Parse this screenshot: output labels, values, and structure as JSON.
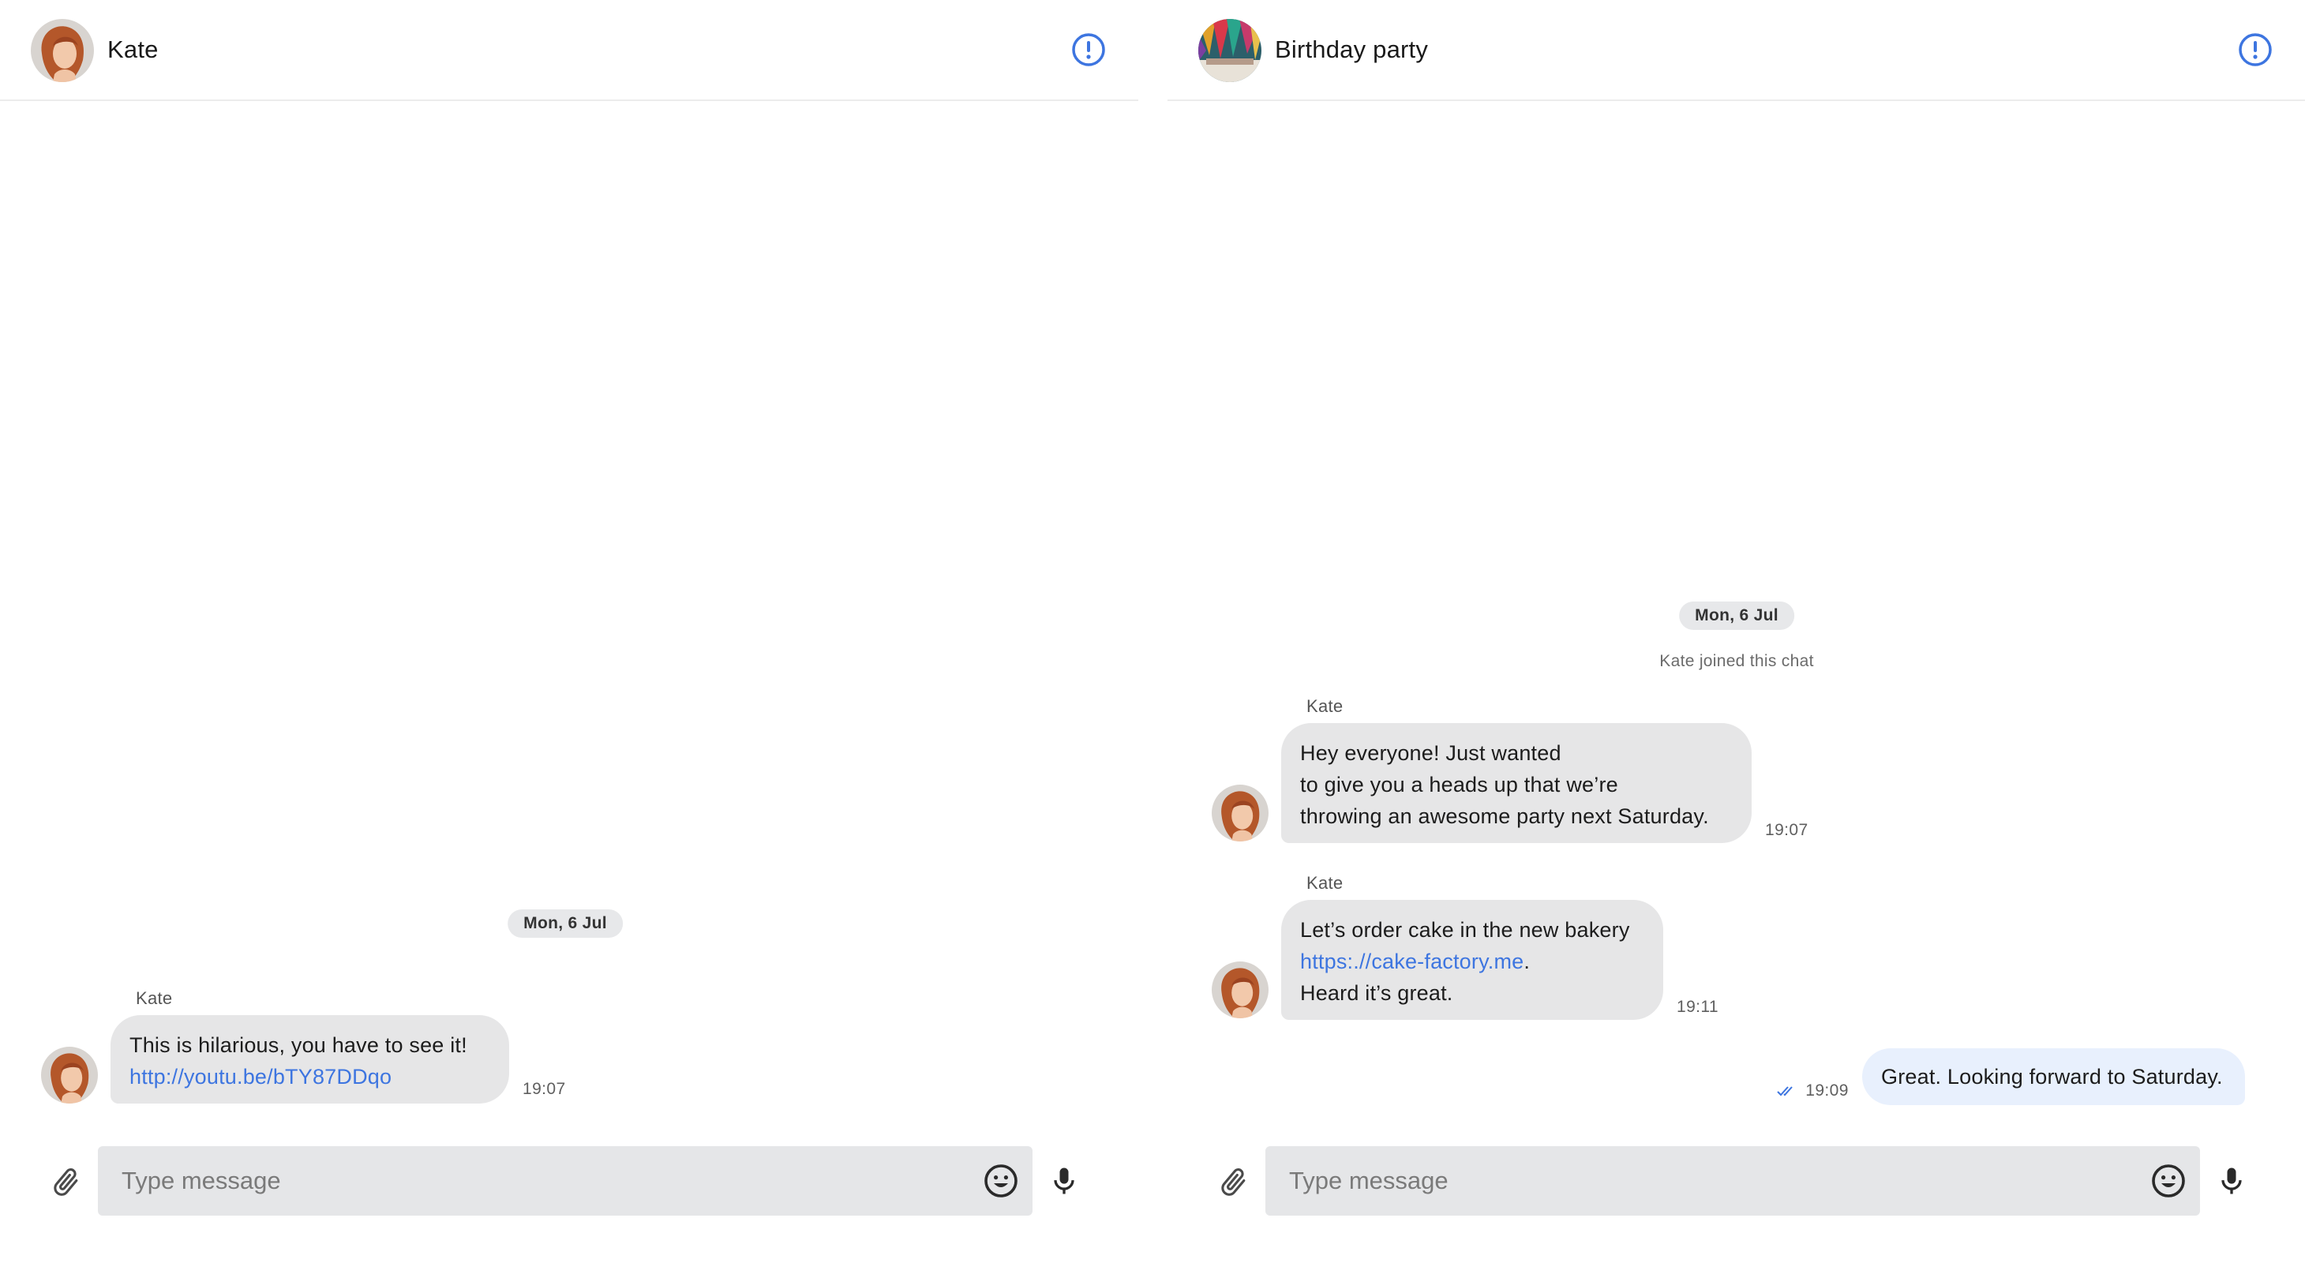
{
  "colors": {
    "accent": "#3d75e0",
    "bubble_incoming": "#e6e6e7",
    "bubble_outgoing": "#e8f0fd",
    "date_pill": "#e7e8ea",
    "composer_bg": "#e5e6e8"
  },
  "left_chat": {
    "header": {
      "title": "Kate",
      "info_icon": "info-circle-icon"
    },
    "date_separator": "Mon, 6 Jul",
    "messages": [
      {
        "sender": "Kate",
        "text_line1": "This is hilarious, you have to see it!",
        "link": "http://youtu.be/bTY87DDqo",
        "time": "19:07"
      }
    ],
    "composer": {
      "placeholder": "Type message",
      "attach_icon": "paperclip-icon",
      "emoji_icon": "emoji-icon",
      "mic_icon": "microphone-icon"
    }
  },
  "right_chat": {
    "header": {
      "title": "Birthday party",
      "info_icon": "info-circle-icon"
    },
    "date_separator": "Mon, 6 Jul",
    "system_message": "Kate joined this chat",
    "messages": [
      {
        "sender": "Kate",
        "lines": [
          "Hey everyone! Just wanted",
          "to give you a heads up that we’re",
          "throwing an awesome party next Saturday."
        ],
        "time": "19:07"
      },
      {
        "sender": "Kate",
        "line1": "Let’s order cake in the new bakery",
        "link": "https:.//cake-factory.me",
        "link_suffix": ".",
        "line3": "Heard it’s great.",
        "time": "19:11"
      }
    ],
    "outgoing": {
      "text": "Great. Looking forward to Saturday.",
      "time": "19:09",
      "status_icon": "double-check-icon"
    },
    "composer": {
      "placeholder": "Type message",
      "attach_icon": "paperclip-icon",
      "emoji_icon": "emoji-icon",
      "mic_icon": "microphone-icon"
    }
  }
}
